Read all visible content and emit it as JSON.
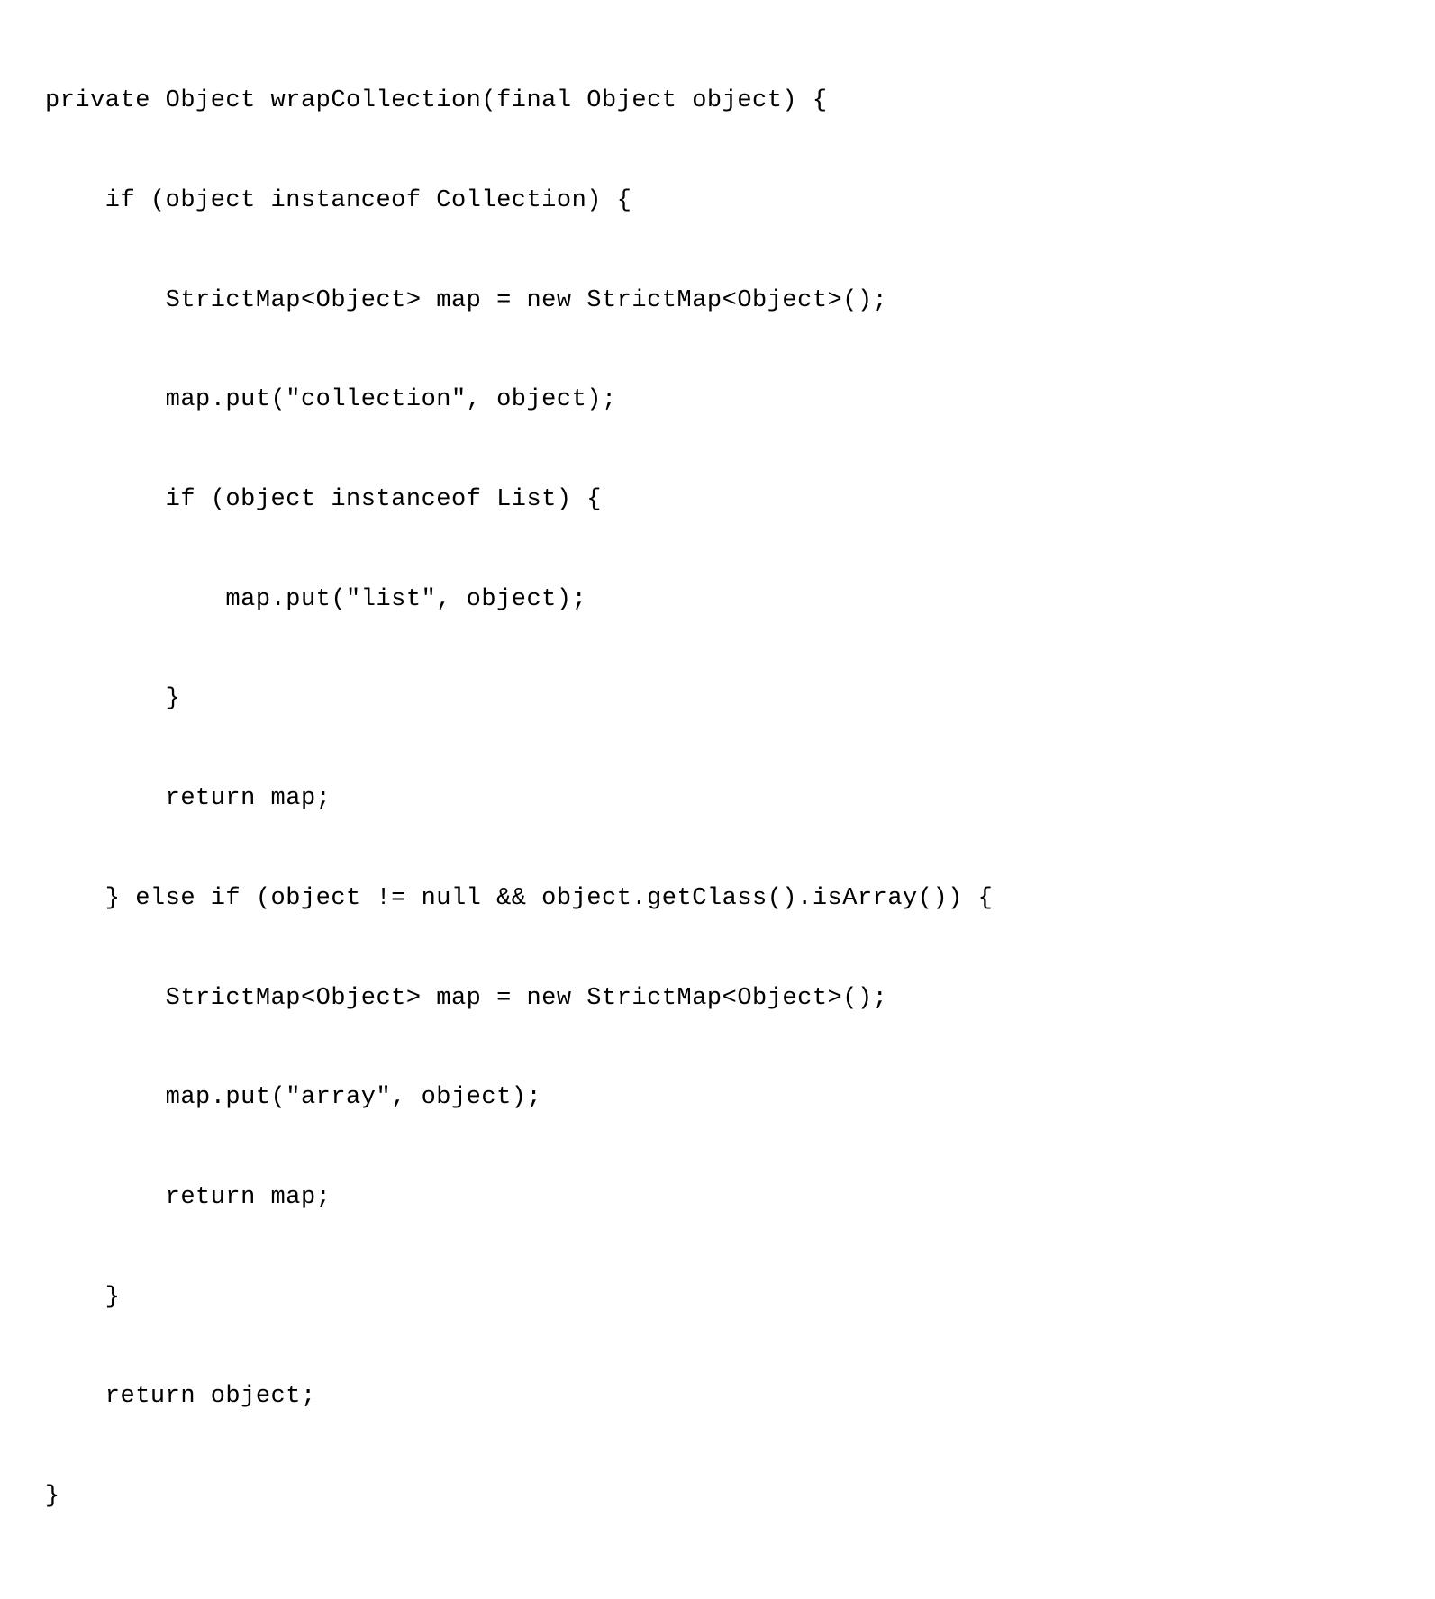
{
  "code": {
    "lines": [
      "private Object wrapCollection(final Object object) {",
      "    if (object instanceof Collection) {",
      "        StrictMap<Object> map = new StrictMap<Object>();",
      "        map.put(\"collection\", object);",
      "        if (object instanceof List) {",
      "            map.put(\"list\", object);",
      "        }",
      "        return map;",
      "    } else if (object != null && object.getClass().isArray()) {",
      "        StrictMap<Object> map = new StrictMap<Object>();",
      "        map.put(\"array\", object);",
      "        return map;",
      "    }",
      "    return object;",
      "}"
    ]
  }
}
